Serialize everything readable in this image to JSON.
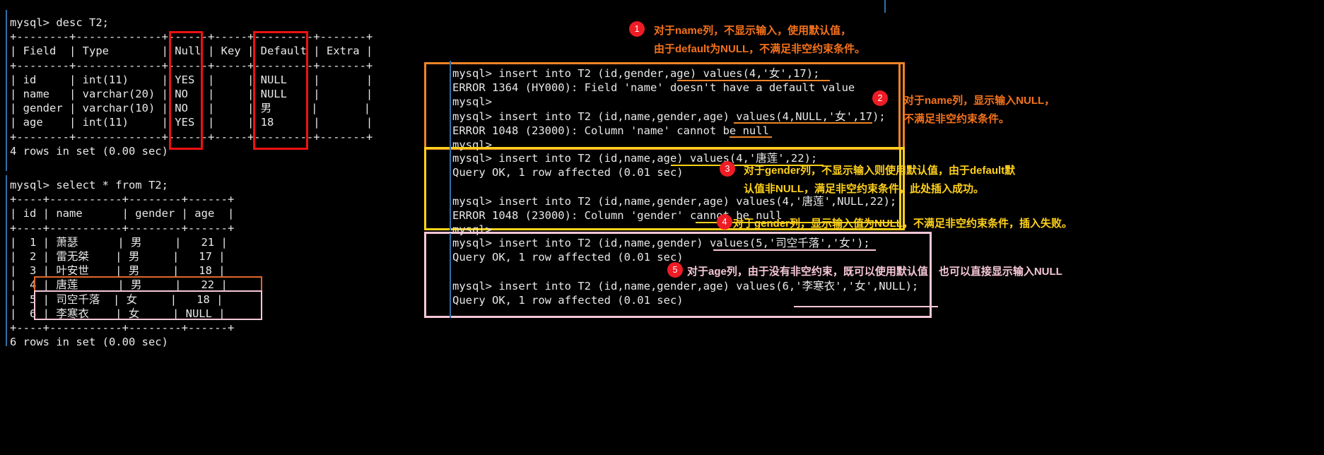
{
  "left": {
    "desc_command": "mysql> desc T2;",
    "desc_table": "+--------+-------------+------+-----+---------+-------+\n| Field  | Type        | Null | Key | Default | Extra |\n+--------+-------------+------+-----+---------+-------+\n| id     | int(11)     | YES  |     | NULL    |       |\n| name   | varchar(20) | NO   |     | NULL    |       |\n| gender | varchar(10) | NO   |     | 男      |       |\n| age    | int(11)     | YES  |     | 18      |       |\n+--------+-------------+------+-----+---------+-------+\n4 rows in set (0.00 sec)",
    "select_command": "mysql> select * from T2;",
    "select_table": "+----+-----------+--------+------+\n| id | name      | gender | age  |\n+----+-----------+--------+------+\n|  1 | 萧瑟      | 男     |   21 |\n|  2 | 雷无桀    | 男     |   17 |\n|  3 | 叶安世    | 男     |   18 |\n|  4 | 唐莲      | 男     |   22 |\n|  5 | 司空千落  | 女     |   18 |\n|  6 | 李寒衣    | 女     | NULL |\n+----+-----------+--------+------+\n6 rows in set (0.00 sec)",
    "desc_columns": [
      "Field",
      "Type",
      "Null",
      "Key",
      "Default",
      "Extra"
    ],
    "desc_rows": [
      {
        "Field": "id",
        "Type": "int(11)",
        "Null": "YES",
        "Key": "",
        "Default": "NULL",
        "Extra": ""
      },
      {
        "Field": "name",
        "Type": "varchar(20)",
        "Null": "NO",
        "Key": "",
        "Default": "NULL",
        "Extra": ""
      },
      {
        "Field": "gender",
        "Type": "varchar(10)",
        "Null": "NO",
        "Key": "",
        "Default": "男",
        "Extra": ""
      },
      {
        "Field": "age",
        "Type": "int(11)",
        "Null": "YES",
        "Key": "",
        "Default": "18",
        "Extra": ""
      }
    ],
    "desc_footer": "4 rows in set (0.00 sec)",
    "select_columns": [
      "id",
      "name",
      "gender",
      "age"
    ],
    "select_rows": [
      {
        "id": "1",
        "name": "萧瑟",
        "gender": "男",
        "age": "21"
      },
      {
        "id": "2",
        "name": "雷无桀",
        "gender": "男",
        "age": "17"
      },
      {
        "id": "3",
        "name": "叶安世",
        "gender": "男",
        "age": "18"
      },
      {
        "id": "4",
        "name": "唐莲",
        "gender": "男",
        "age": "22"
      },
      {
        "id": "5",
        "name": "司空千落",
        "gender": "女",
        "age": "18"
      },
      {
        "id": "6",
        "name": "李寒衣",
        "gender": "女",
        "age": "NULL"
      }
    ],
    "select_footer": "6 rows in set (0.00 sec)"
  },
  "right": {
    "block1": "mysql> insert into T2 (id,gender,age) values(4,'女',17);\nERROR 1364 (HY000): Field 'name' doesn't have a default value\nmysql>\nmysql> insert into T2 (id,name,gender,age) values(4,NULL,'女',17);\nERROR 1048 (23000): Column 'name' cannot be null\nmysql>",
    "block2": "mysql> insert into T2 (id,name,age) values(4,'唐莲',22);\nQuery OK, 1 row affected (0.01 sec)\n\nmysql> insert into T2 (id,name,gender,age) values(4,'唐莲',NULL,22);\nERROR 1048 (23000): Column 'gender' cannot be null\nmysql>",
    "block3": "mysql> insert into T2 (id,name,gender) values(5,'司空千落','女');\nQuery OK, 1 row affected (0.01 sec)\n\nmysql> insert into T2 (id,name,gender,age) values(6,'李寒衣','女',NULL);\nQuery OK, 1 row affected (0.01 sec)"
  },
  "annotations": [
    {
      "number": "1",
      "color": "#f4721b",
      "line1": "对于name列，不显示输入，使用默认值，",
      "line2": "由于default为NULL，不满足非空约束条件。"
    },
    {
      "number": "2",
      "color": "#f4721b",
      "line1": "对于name列，显示输入NULL，",
      "line2": "不满足非空约束条件。"
    },
    {
      "number": "3",
      "color": "#ffd11a",
      "line1": "对于gender列，不显示输入则使用默认值，由于default默",
      "line2": "认值非NULL，满足非空约束条件，此处插入成功。"
    },
    {
      "number": "4",
      "color": "#ffd11a",
      "line1": "对于gender列，显示输入值为NULL，不满足非空约束条件，插入失败。",
      "line2": ""
    },
    {
      "number": "5",
      "color": "#f7c7d8",
      "line1": "对于age列，由于没有非空约束，既可以使用默认值，也可以直接显示输入NULL",
      "line2": ""
    }
  ],
  "colors": {
    "terminal_bg": "#000000",
    "terminal_fg": "#e8e8e8",
    "highlight_red": "#ee1111",
    "orange": "#f08326",
    "yellow": "#ffd11a",
    "pink": "#f7c7d8",
    "badge_red": "#ee1c25",
    "cursor_blue": "#2f6fa8"
  }
}
